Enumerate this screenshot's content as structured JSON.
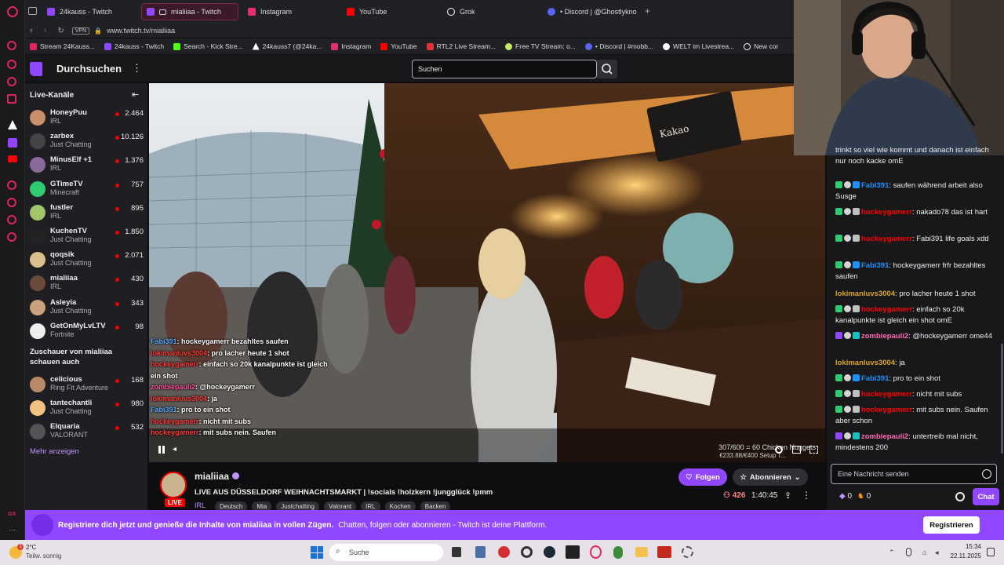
{
  "browser": {
    "tabs": [
      {
        "label": "24kauss - Twitch",
        "color": "#9147ff"
      },
      {
        "label": "mialiiaa - Twitch",
        "color": "#9147ff"
      },
      {
        "label": "Instagram",
        "color": "#e1306c"
      },
      {
        "label": "YouTube",
        "color": "#ff0000"
      },
      {
        "label": "Grok",
        "color": "#ffffff"
      },
      {
        "label": "• Discord | @Ghostlykno",
        "color": "#5865f2"
      }
    ],
    "address": "www.twitch.tv/mialiiaa",
    "vpn": "VPN",
    "bookmarks": [
      "Stream 24Kauss...",
      "24kauss - Twitch",
      "Search - Kick Stre...",
      "24kauss7 (@24ka...",
      "Instagram",
      "YouTube",
      "RTL2 Live Stream...",
      "Free TV Stream: o...",
      "• Discord | #mobb...",
      "WELT im Livestrea...",
      "New cor"
    ]
  },
  "twitch": {
    "browse": "Durchsuchen",
    "search_placeholder": "Suchen",
    "sidebar": {
      "header": "Live-Kanäle",
      "channels": [
        {
          "name": "HoneyPuu",
          "game": "IRL",
          "viewers": "2.464",
          "color": "#c98f6a"
        },
        {
          "name": "zarbex",
          "game": "Just Chatting",
          "viewers": "10.126",
          "color": "#444"
        },
        {
          "name": "MinusElf +1",
          "game": "IRL",
          "viewers": "1.376",
          "color": "#8a6a9a"
        },
        {
          "name": "GTimeTV",
          "game": "Minecraft",
          "viewers": "757",
          "color": "#2ecc71"
        },
        {
          "name": "fustler",
          "game": "IRL",
          "viewers": "895",
          "color": "#a4c66a"
        },
        {
          "name": "KuchenTV",
          "game": "Just Chatting",
          "viewers": "1.850",
          "color": "#222"
        },
        {
          "name": "qoqsik",
          "game": "Just Chatting",
          "viewers": "2.071",
          "color": "#d9c08e"
        },
        {
          "name": "mialiiaa",
          "game": "IRL",
          "viewers": "430",
          "color": "#6b4a3a"
        },
        {
          "name": "Asleyia",
          "game": "Just Chatting",
          "viewers": "343",
          "color": "#c9a27c"
        },
        {
          "name": "GetOnMyLvLTV",
          "game": "Fortnite",
          "viewers": "98",
          "color": "#eee"
        }
      ],
      "also_watching_header": "Zuschauer von mialiiaa schauen auch",
      "also_watching": [
        {
          "name": "celicious",
          "game": "Ring Fit Adventure",
          "viewers": "168",
          "color": "#b88a6a"
        },
        {
          "name": "tantechantli",
          "game": "Just Chatting",
          "viewers": "980",
          "color": "#f1c27d"
        },
        {
          "name": "Elquaria",
          "game": "VALORANT",
          "viewers": "532",
          "color": "#555"
        }
      ],
      "show_more": "Mehr anzeigen"
    },
    "video": {
      "goal": "307/600 = 60 Chicken Nuggets",
      "goal2": "€233.88/€400 Setup T...",
      "booth_sign": "Kakao",
      "overlay_chat": [
        {
          "user": "Fabi391",
          "text": ": hockeygamerr  bezahltes saufen"
        },
        {
          "user": "lokimanluvs3004",
          "text": ": pro lacher heute 1 shot"
        },
        {
          "user": "hockeygamerr",
          "text": ": einfach so 20k kanalpunkte ist gleich ein shot"
        },
        {
          "user": "zombiepauli2",
          "text": ": @hockeygamerr"
        },
        {
          "user": "lokimanluvs3004",
          "text": ": ja"
        },
        {
          "user": "Fabi391",
          "text": ": pro to ein shot"
        },
        {
          "user": "hockeygamerr",
          "text": ": nicht mit subs"
        },
        {
          "user": "hockeygamerr",
          "text": ": mit subs nein. Saufen"
        }
      ]
    },
    "stream": {
      "channel": "mialiiaa",
      "title": "LIVE AUS DÜSSELDORF  WEIHNACHTSMARKT  | !socials !holzkern !junggl​ück !pmm",
      "category": "IRL",
      "tags": [
        "Deutsch",
        "Mia",
        "Justchatting",
        "Valorant",
        "IRL",
        "Kochen",
        "Backen"
      ],
      "live": "LIVE",
      "follow": "Folgen",
      "subscribe": "Abonnieren",
      "viewers": "426",
      "uptime": "1:40:45"
    },
    "chat": {
      "messages": [
        {
          "user": "",
          "color": "#efeff1",
          "text": "trinkt so viel wie kommt und danach ist einfach nur noch kacke omE"
        },
        {
          "user": "Fabi391",
          "color": "#1e90ff",
          "text": ": saufen während arbeit also Susge"
        },
        {
          "user": "hockeygamerr",
          "color": "#ff0000",
          "text": ": nakado78 das ist hart"
        },
        {
          "user": "hockeygamerr",
          "color": "#ff0000",
          "text": ": Fabi391 life goals xdd"
        },
        {
          "user": "Fabi391",
          "color": "#1e90ff",
          "text": ": hockeygamerr frfr bezahltes saufen"
        },
        {
          "user": "lokimanluvs3004",
          "color": "#daa520",
          "text": ": pro lacher heute 1 shot"
        },
        {
          "user": "hockeygamerr",
          "color": "#ff0000",
          "text": ": einfach so 20k kanalpunkte ist gleich ein shot omE"
        },
        {
          "user": "zombiepauli2",
          "color": "#ff69b4",
          "text": ": @hockeygamerr ome44"
        },
        {
          "user": "lokimanluvs3004",
          "color": "#daa520",
          "text": ": ja"
        },
        {
          "user": "Fabi391",
          "color": "#1e90ff",
          "text": ": pro to ein shot"
        },
        {
          "user": "hockeygamerr",
          "color": "#ff0000",
          "text": ": nicht mit subs"
        },
        {
          "user": "hockeygamerr",
          "color": "#ff0000",
          "text": ": mit subs nein. Saufen aber schon"
        },
        {
          "user": "zombiepauli2",
          "color": "#ff69b4",
          "text": ": untertreib mal nicht, mindestens 200"
        }
      ],
      "input_placeholder": "Eine Nachricht senden",
      "points_a": "0",
      "points_b": "0",
      "chat_button": "Chat"
    },
    "banner": {
      "text": "Registriere dich jetzt und genieße die Inhalte von mialiiaa in vollen Zügen.",
      "text2": "Chatten, folgen oder abonnieren - Twitch ist deine Plattform.",
      "register": "Registrieren"
    }
  },
  "taskbar": {
    "weather_temp": "2°C",
    "weather_desc": "Teilw. sonnig",
    "search": "Suche",
    "time": "15:34",
    "date": "22.11.2025",
    "weather_badge": "1"
  }
}
